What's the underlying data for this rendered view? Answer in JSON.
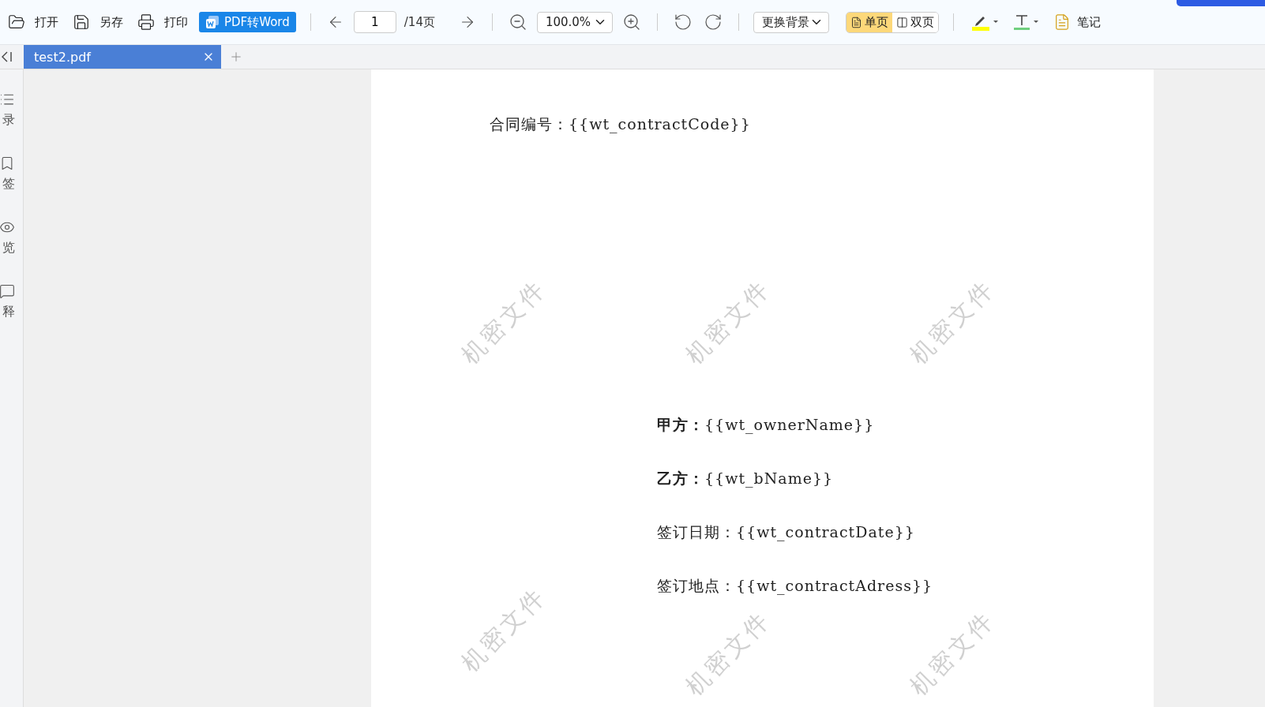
{
  "toolbar": {
    "file_actions": [
      {
        "kind": "open",
        "label": "打开"
      },
      {
        "kind": "save",
        "label": "另存"
      },
      {
        "kind": "print",
        "label": "打印"
      }
    ],
    "convert_button": {
      "label": "PDF转Word"
    },
    "page_field": {
      "value": "1"
    },
    "page_total": "/14页",
    "zoom_select": {
      "value": "100.0%"
    },
    "background_select": {
      "value": "更换背景"
    },
    "view_modes": [
      {
        "kind": "single",
        "label": "单页",
        "selected": true
      },
      {
        "kind": "double",
        "label": "双页",
        "selected": false
      }
    ],
    "notes_button": {
      "label": "笔记"
    }
  },
  "tabs": [
    {
      "label": "test2.pdf",
      "selected": true
    }
  ],
  "sidebar": {
    "items": [
      {
        "kind": "contents",
        "label": "录"
      },
      {
        "kind": "bookmark",
        "label": "签"
      },
      {
        "kind": "preview",
        "label": "览"
      },
      {
        "kind": "comment",
        "label": "释"
      }
    ]
  },
  "document": {
    "code_line": "合同编号：{{wt_contractCode}}",
    "fields": [
      "**甲方：**{{wt_ownerName}}",
      "**乙方：**{{wt_bName}}",
      "签订日期：{{wt_contractDate}}",
      "签订地点：{{wt_contractAdress}}"
    ],
    "watermarks": [
      "机密文件",
      "机密文件",
      "机密文件",
      "机密文件",
      "机密文件",
      "机密文件"
    ]
  }
}
